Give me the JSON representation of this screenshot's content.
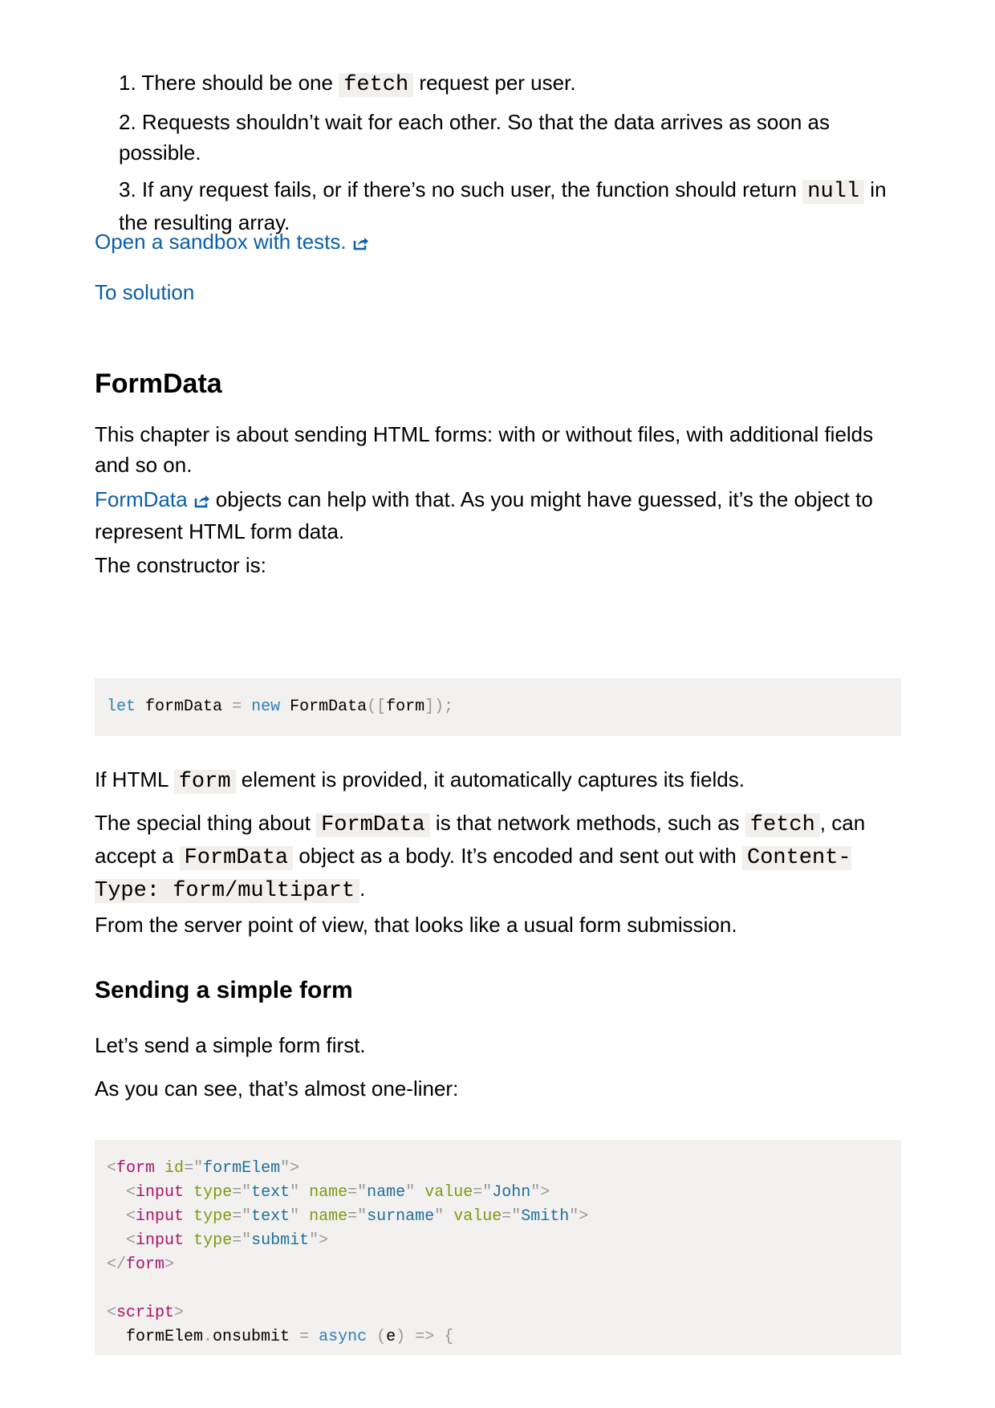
{
  "list": [
    {
      "num": "1.",
      "pre": "There should be one ",
      "code": "fetch",
      "post": " request per user."
    },
    {
      "num": "2.",
      "pre": "Requests shouldn’t wait for each other. So that the data arrives as soon as possible."
    },
    {
      "num": "3.",
      "pre": "If any request fails, or if there’s no such user, the function should return ",
      "code": "null",
      "post": " in the resulting array."
    }
  ],
  "links": {
    "sandbox": "Open a sandbox with tests.",
    "solution": "To solution",
    "formdata": "FormData"
  },
  "heading": "FormData",
  "intro": "This chapter is about sending HTML forms: with or without files, with additional fields and so on.",
  "formdata_para_rest": " objects can help with that. As you might have guessed, it’s the object to represent HTML form data.",
  "constructor_label": "The constructor is:",
  "code1": {
    "kw1": "let",
    "var": " formData ",
    "eq": "=",
    "kw2": "new",
    "ctor": " FormData",
    "p1": "([",
    "arg": "form",
    "p2": "]);"
  },
  "p_form": {
    "pre": "If HTML ",
    "code": "form",
    "post": " element is provided, it automatically captures its fields."
  },
  "p_special": {
    "t1": "The special thing about ",
    "c1": "FormData",
    "t2": " is that network methods, such as ",
    "c2": "fetch",
    "t3": ", can accept a ",
    "c3": "FormData",
    "t4": " object as a body. It’s encoded and sent out with ",
    "c4": "Content-Type: form/multipart",
    "t5": "."
  },
  "p_server": "From the server point of view, that looks like a usual form submission.",
  "subheading": "Sending a simple form",
  "p_send": "Let’s send a simple form first.",
  "p_oneliner": "As you can see, that’s almost one-liner:",
  "code2": {
    "form_open": {
      "tag": "form",
      "attr": "id",
      "val": "formElem"
    },
    "inputs": [
      {
        "tag": "input",
        "a1": "type",
        "v1": "text",
        "a2": "name",
        "v2": "name",
        "a3": "value",
        "v3": "John"
      },
      {
        "tag": "input",
        "a1": "type",
        "v1": "text",
        "a2": "name",
        "v2": "surname",
        "a3": "value",
        "v3": "Smith"
      },
      {
        "tag": "input",
        "a1": "type",
        "v1": "submit"
      }
    ],
    "form_close": "form",
    "script_tag": "script",
    "last": {
      "obj": "formElem",
      "dot": ".",
      "prop": "onsubmit",
      "eq": "=",
      "kw": "async",
      "param": "e",
      "arrow": "=>",
      "brace": "{"
    }
  },
  "icons": {
    "external": "external-link-icon"
  }
}
